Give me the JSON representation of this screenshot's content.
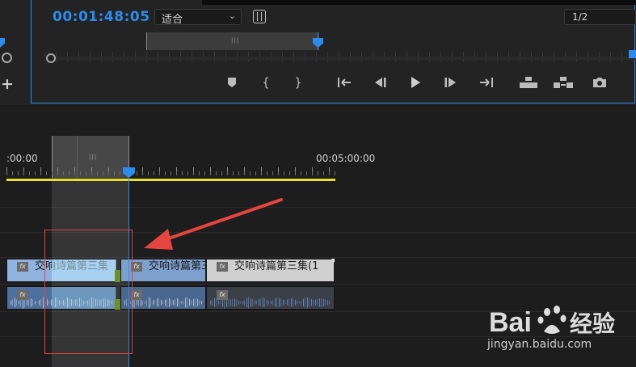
{
  "monitor": {
    "timecode": "00:01:48:05",
    "fit_value": "适合",
    "resolution": "1/2",
    "accent_color": "#2d8ceb"
  },
  "transport": {
    "buttons": [
      {
        "name": "add-marker-button",
        "icon": "marker-icon",
        "glyph": "⬥"
      },
      {
        "name": "mark-in-button",
        "icon": "mark-in-icon",
        "glyph": "{"
      },
      {
        "name": "mark-out-button",
        "icon": "mark-out-icon",
        "glyph": "}"
      },
      {
        "name": "go-to-in-button",
        "icon": "go-to-in-icon",
        "glyph": "{←"
      },
      {
        "name": "step-back-button",
        "icon": "step-back-icon",
        "glyph": "◀|"
      },
      {
        "name": "play-button",
        "icon": "play-icon",
        "glyph": "▶"
      },
      {
        "name": "step-forward-button",
        "icon": "step-forward-icon",
        "glyph": "|▶"
      },
      {
        "name": "go-to-out-button",
        "icon": "go-to-out-icon",
        "glyph": "→}"
      },
      {
        "name": "lift-button",
        "icon": "lift-icon",
        "glyph": "⏏"
      },
      {
        "name": "extract-button",
        "icon": "extract-icon",
        "glyph": "⏏"
      },
      {
        "name": "export-frame-button",
        "icon": "camera-icon",
        "glyph": "📷"
      }
    ]
  },
  "timeline": {
    "ruler_start": ":00:00",
    "ruler_mark": "00:05:00:00",
    "work_area_color": "#e6e02a",
    "clips": [
      {
        "name": "video-clip-1",
        "label": "交响诗篇第三集",
        "fx": "fx"
      },
      {
        "name": "video-clip-2",
        "label": "交响诗篇第三集",
        "fx": "fx"
      },
      {
        "name": "video-clip-3",
        "label": "交响诗篇第三集(1",
        "fx": "fx"
      }
    ],
    "audio_fx": [
      "fx",
      "fx",
      "fx"
    ]
  },
  "watermark": {
    "brand": "Bai 经验",
    "url": "jingyan.baidu.com"
  }
}
